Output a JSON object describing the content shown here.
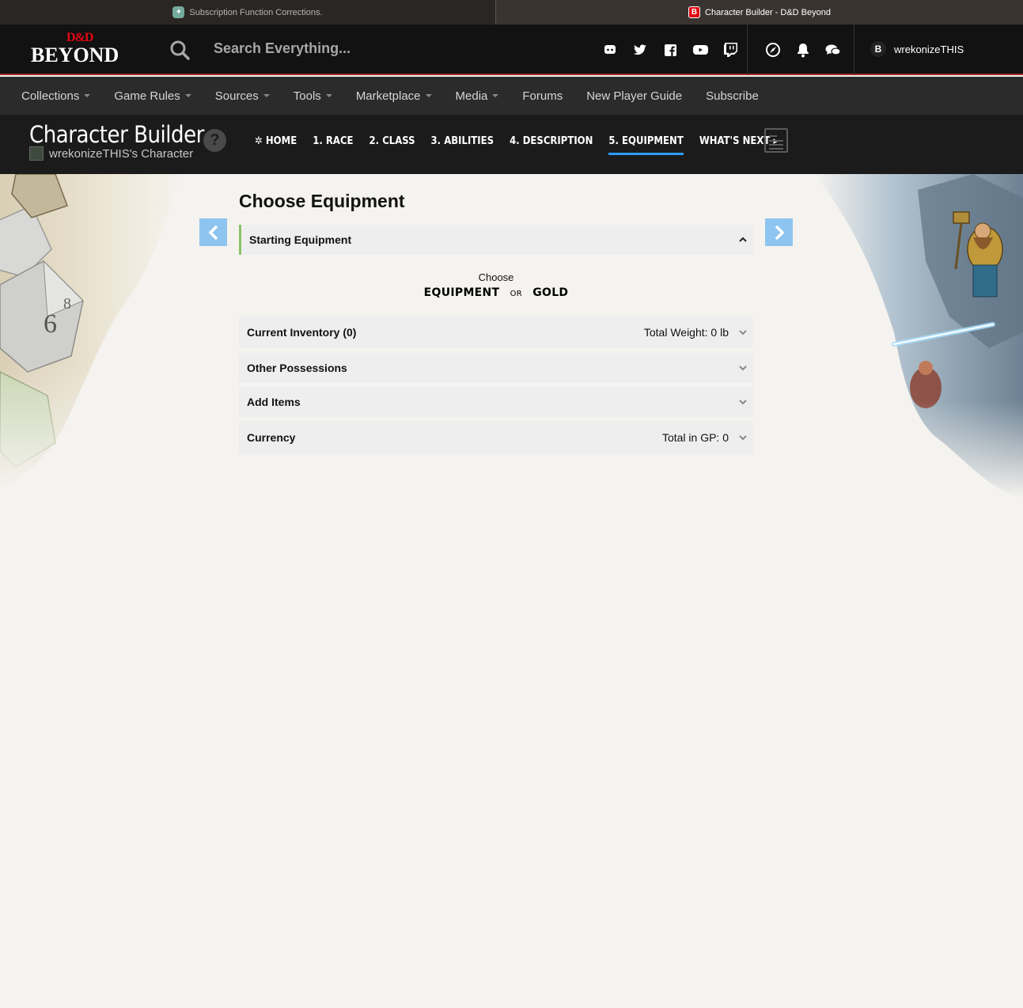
{
  "browser": {
    "tabs": [
      {
        "title": "Subscription Function Corrections.",
        "favicon": "chatgpt-icon"
      },
      {
        "title": "Character Builder - D&D Beyond",
        "favicon": "ddb-icon",
        "favicon_letter": "B"
      }
    ]
  },
  "header": {
    "logo_top": "D&D",
    "logo_bottom": "BEYOND",
    "search_placeholder": "Search Everything...",
    "social_icons": [
      "discord-icon",
      "twitter-icon",
      "facebook-icon",
      "youtube-icon",
      "twitch-icon"
    ],
    "utility_icons": [
      "compass-icon",
      "bell-icon",
      "chat-icon"
    ],
    "user": {
      "avatar_letter": "B",
      "name": "wrekonizeTHIS"
    }
  },
  "nav": {
    "items": [
      {
        "label": "Collections",
        "has_caret": true
      },
      {
        "label": "Game Rules",
        "has_caret": true
      },
      {
        "label": "Sources",
        "has_caret": true
      },
      {
        "label": "Tools",
        "has_caret": true
      },
      {
        "label": "Marketplace",
        "has_caret": true
      },
      {
        "label": "Media",
        "has_caret": true
      },
      {
        "label": "Forums",
        "has_caret": false
      },
      {
        "label": "New Player Guide",
        "has_caret": false
      },
      {
        "label": "Subscribe",
        "has_caret": false
      }
    ]
  },
  "builder": {
    "title": "Character Builder",
    "character_name": "wrekonizeTHIS's Character",
    "help": "?",
    "steps": {
      "home": "HOME",
      "race": "1. RACE",
      "class": "2. CLASS",
      "abilities": "3. ABILITIES",
      "description": "4. DESCRIPTION",
      "equipment": "5. EQUIPMENT",
      "whats_next": "WHAT'S NEXT"
    },
    "active_step": "equipment"
  },
  "main": {
    "title": "Choose Equipment",
    "starting_equipment": "Starting Equipment",
    "choose_label": "Choose",
    "option_equipment": "EQUIPMENT",
    "option_or": "OR",
    "option_gold": "GOLD",
    "inventory_label": "Current Inventory (0)",
    "inventory_weight": "Total Weight: 0 lb",
    "other_possessions": "Other Possessions",
    "add_items": "Add Items",
    "currency_label": "Currency",
    "currency_total": "Total in GP: 0"
  },
  "colors": {
    "accent_blue": "#2a9cff",
    "arrow_blue": "#8ec5f0",
    "green_marker": "#8ac266",
    "ddb_red": "#e40712"
  }
}
